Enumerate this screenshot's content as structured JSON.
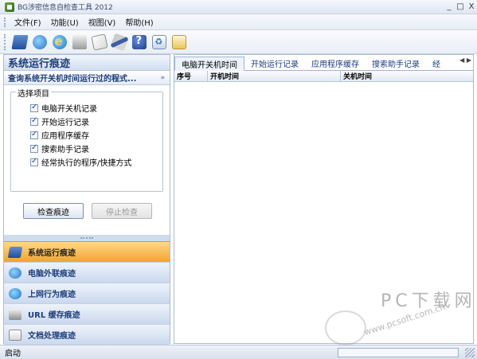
{
  "window": {
    "title": "BG涉密信息自检查工具 2012",
    "controls": [
      "_",
      "□",
      "X"
    ]
  },
  "menu": [
    "文件(F)",
    "功能(U)",
    "视图(V)",
    "帮助(H)"
  ],
  "toolbar": {
    "icons": [
      "monitor-icon",
      "network-icon",
      "ie-icon",
      "url-icon",
      "document-icon",
      "brush-icon",
      "help-icon",
      "recycle-icon",
      "exit-icon"
    ]
  },
  "left": {
    "title": "系统运行痕迹",
    "subtitle": "查询系统开关机时间运行过的程式...",
    "collapse": "»",
    "group_label": "选择项目",
    "options": [
      "电脑开关机记录",
      "开始运行记录",
      "应用程序缓存",
      "搜索助手记录",
      "经常执行的程序/快捷方式"
    ],
    "check_button": "检查痕迹",
    "stop_button": "停止检查",
    "nav": [
      "系统运行痕迹",
      "电脑外联痕迹",
      "上网行为痕迹",
      "URL 缓存痕迹",
      "文档处理痕迹"
    ],
    "footer_caret": "▼"
  },
  "right": {
    "tabs": [
      "电脑开关机时间",
      "开始运行记录",
      "应用程序缓存",
      "搜索助手记录",
      "经"
    ],
    "tab_scroll": "◀ ▶",
    "columns": [
      "序号",
      "开机时间",
      "关机时间"
    ]
  },
  "status": {
    "text": "启动"
  },
  "watermark": {
    "brand": "PC下载网",
    "url": "www.pcsoft.com.cn"
  },
  "colors": {
    "accent_nav_active": "#f3a32e",
    "panel_blue": "#dce6f4",
    "text_blue": "#1d3d7a"
  }
}
